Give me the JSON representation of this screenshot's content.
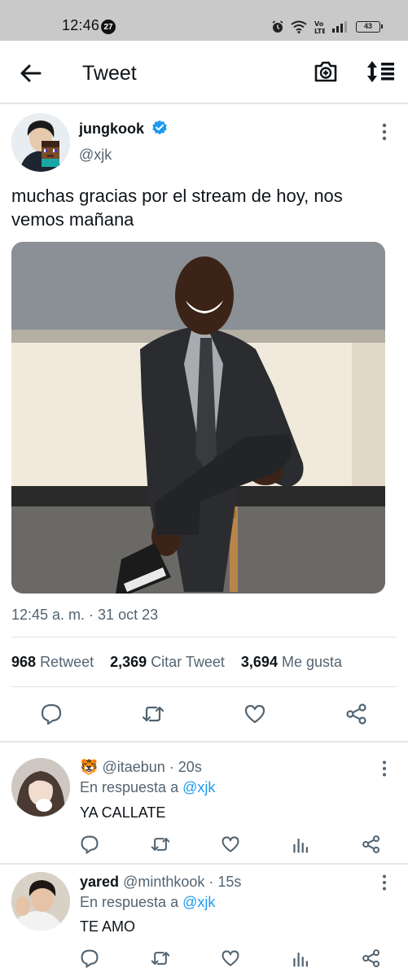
{
  "status_bar": {
    "time": "12:46",
    "notification_count": "27",
    "battery": "43",
    "network": "Vo LTE"
  },
  "header": {
    "title": "Tweet",
    "back_icon": "arrow-left-icon",
    "camera_icon": "camera-plus-icon",
    "sort_icon": "sort-icon"
  },
  "tweet": {
    "author_name": "jungkook",
    "author_handle": "@xjk",
    "text": "muchas gracias por el stream de hoy, nos vemos mañana",
    "timestamp": "12:45 a. m. · 31 oct 23",
    "stats": {
      "retweets": "968",
      "retweets_label": "Retweet",
      "quotes": "2,369",
      "quotes_label": "Citar Tweet",
      "likes": "3,694",
      "likes_label": "Me gusta"
    },
    "accent_color": "#1d9bf0"
  },
  "replies": [
    {
      "name": "",
      "emoji": "🐯",
      "handle": "@itaebun",
      "time": "20s",
      "reply_prefix": "En respuesta a",
      "reply_to": "@xjk",
      "text": "YA CALLATE"
    },
    {
      "name": "yared",
      "emoji": "",
      "handle": "@minthkook",
      "time": "15s",
      "reply_prefix": "En respuesta a",
      "reply_to": "@xjk",
      "text": "TE AMO"
    }
  ]
}
